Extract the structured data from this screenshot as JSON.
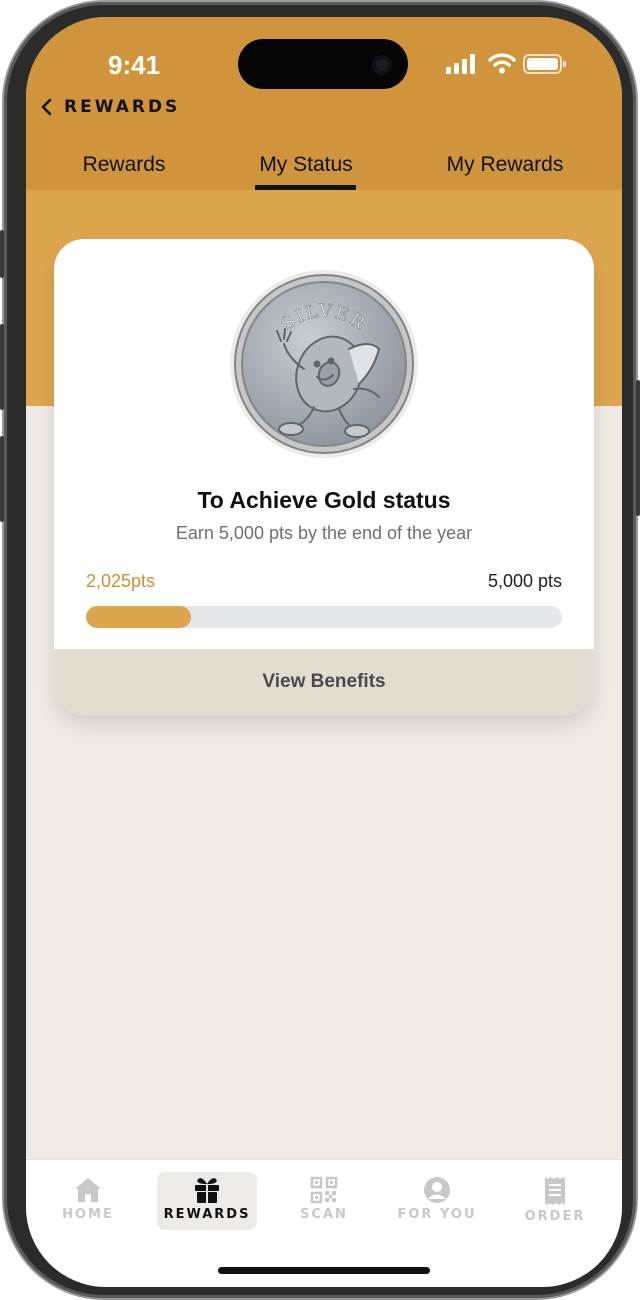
{
  "status_bar": {
    "time": "9:41"
  },
  "header": {
    "back_label": "REWARDS"
  },
  "tabs": [
    {
      "label": "Rewards"
    },
    {
      "label": "My Status"
    },
    {
      "label": "My Rewards"
    }
  ],
  "active_tab": "My Status",
  "status_card": {
    "badge_text": "SILVER",
    "title": "To Achieve Gold status",
    "subtitle": "Earn 5,000 pts by the end of the year",
    "current_points": "2,025pts",
    "target_points": "5,000 pts",
    "progress_fraction": 0.22,
    "benefits_button": "View Benefits"
  },
  "bottom_nav": [
    {
      "label": "HOME",
      "icon": "home-icon"
    },
    {
      "label": "REWARDS",
      "icon": "gift-icon"
    },
    {
      "label": "SCAN",
      "icon": "qr-code-icon"
    },
    {
      "label": "FOR YOU",
      "icon": "user-circle-icon"
    },
    {
      "label": "ORDER",
      "icon": "receipt-icon"
    }
  ],
  "active_nav": "REWARDS",
  "colors": {
    "header": "#d0953c",
    "band": "#dea54f",
    "background": "#efebe4",
    "accent_text": "#c98f35",
    "progress_fill": "#dda64e",
    "progress_track": "#e6e7ea"
  }
}
